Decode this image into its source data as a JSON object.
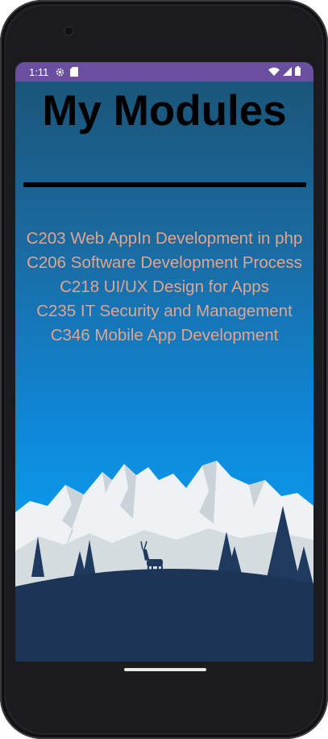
{
  "status_bar": {
    "time": "1:11",
    "icons": [
      "settings-gear-icon",
      "sd-card-icon",
      "wifi-icon",
      "cell-signal-icon",
      "battery-icon"
    ]
  },
  "page": {
    "title": "My Modules"
  },
  "modules": [
    "C203 Web AppIn Development in php",
    "C206 Software Development Process",
    "C218 UI/UX Design for Apps",
    "C235 IT Security and Management",
    "C346 Mobile App Development"
  ],
  "colors": {
    "status_bar": "#6a4fa0",
    "module_text": "#e1a58d",
    "sky_top": "#1a5375",
    "sky_bottom": "#0a9aec",
    "ground": "#1c3557"
  }
}
